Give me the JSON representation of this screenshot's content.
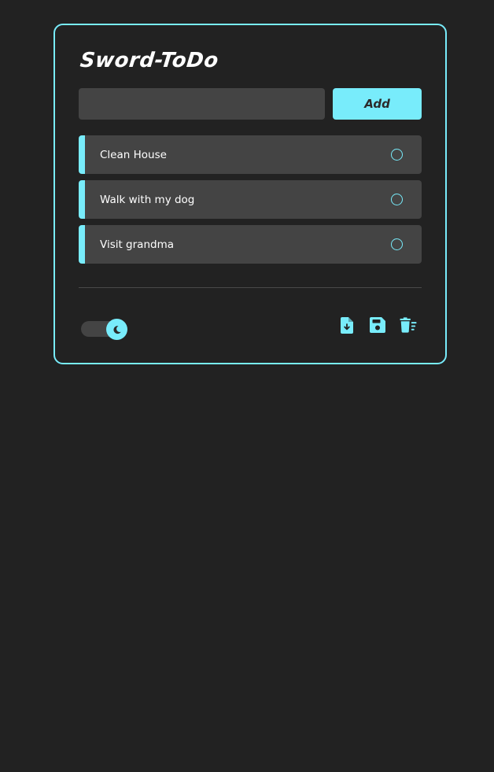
{
  "app": {
    "title": "Sword-ToDo"
  },
  "input": {
    "value": "",
    "placeholder": ""
  },
  "add_button": {
    "label": "Add"
  },
  "todos": [
    {
      "text": "Clean House",
      "done": false
    },
    {
      "text": "Walk with my dog",
      "done": false
    },
    {
      "text": "Visit grandma",
      "done": false
    }
  ],
  "theme_toggle": {
    "state": "dark",
    "icon": "moon-icon"
  },
  "toolbar": {
    "icons": [
      "file-download-icon",
      "save-icon",
      "trash-list-icon"
    ]
  },
  "colors": {
    "accent": "#78ecfb",
    "background": "#222222",
    "surface": "#444444",
    "text": "#ffffff"
  }
}
